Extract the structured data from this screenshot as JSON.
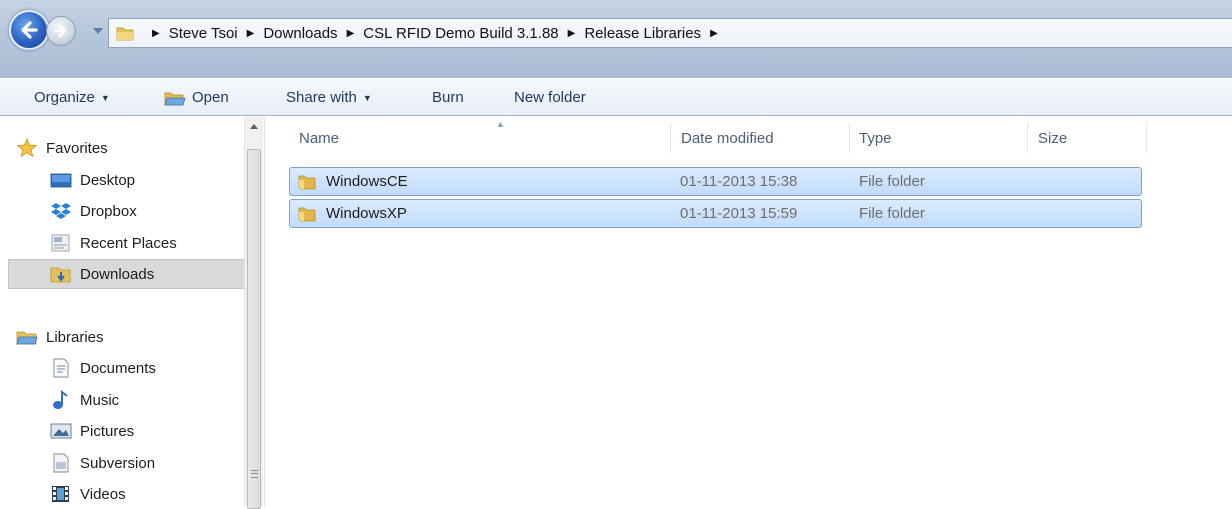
{
  "address_bar": {
    "breadcrumbs": [
      "Steve Tsoi",
      "Downloads",
      "CSL RFID Demo Build 3.1.88",
      "Release Libraries"
    ]
  },
  "toolbar": {
    "organize_label": "Organize",
    "open_label": "Open",
    "share_with_label": "Share with",
    "burn_label": "Burn",
    "new_folder_label": "New folder"
  },
  "navigation": {
    "favorites_label": "Favorites",
    "favorites": [
      {
        "label": "Desktop",
        "icon": "desktop-icon"
      },
      {
        "label": "Dropbox",
        "icon": "dropbox-icon"
      },
      {
        "label": "Recent Places",
        "icon": "recent-places-icon"
      },
      {
        "label": "Downloads",
        "icon": "downloads-icon",
        "selected": true
      }
    ],
    "libraries_label": "Libraries",
    "libraries": [
      {
        "label": "Documents",
        "icon": "documents-icon"
      },
      {
        "label": "Music",
        "icon": "music-icon"
      },
      {
        "label": "Pictures",
        "icon": "pictures-icon"
      },
      {
        "label": "Subversion",
        "icon": "subversion-icon"
      },
      {
        "label": "Videos",
        "icon": "videos-icon"
      }
    ]
  },
  "file_list": {
    "columns": [
      "Name",
      "Date modified",
      "Type",
      "Size"
    ],
    "rows": [
      {
        "name": "WindowsCE",
        "date_modified": "01-11-2013 15:38",
        "type": "File folder",
        "size": "",
        "selected": true
      },
      {
        "name": "WindowsXP",
        "date_modified": "01-11-2013 15:59",
        "type": "File folder",
        "size": "",
        "selected": true
      }
    ]
  },
  "colors": {
    "selection_fill": "#c1dcfc",
    "selection_border": "#7da2ce",
    "toolbar_text": "#1e395b",
    "column_header_text": "#4c607a"
  }
}
